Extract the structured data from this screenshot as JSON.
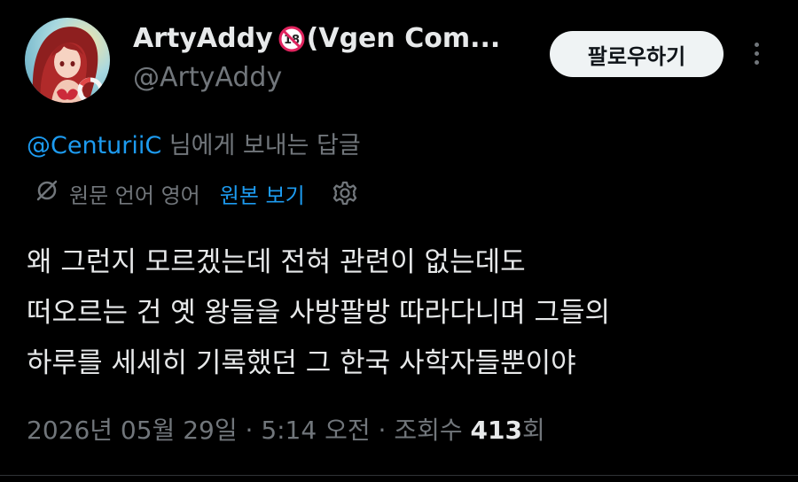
{
  "author": {
    "display_name": "ArtyAddy",
    "display_name_suffix": "(Vgen Com...",
    "age_badge_text": "18",
    "handle": "@ArtyAddy"
  },
  "header": {
    "follow_label": "팔로우하기"
  },
  "reply_context": {
    "mention": "@CenturiiC",
    "suffix": " 님에게 보내는 답글"
  },
  "translation": {
    "language_info": "원문 언어 영어",
    "show_original_label": "원본 보기"
  },
  "tweet": {
    "lines": [
      "왜 그런지 모르겠는데 전혀 관련이 없는데도",
      "떠오르는 건 옛 왕들을 사방팔방 따라다니며 그들의",
      "하루를 세세히 기록했던 그 한국 사학자들뿐이야"
    ]
  },
  "meta": {
    "date": "2026년 05월 29일",
    "separator": " · ",
    "time": "5:14 오전",
    "views_prefix": "조회수 ",
    "views_count": "413",
    "views_suffix": "회"
  },
  "colors": {
    "background": "#000000",
    "text_primary": "#e7e9ea",
    "text_secondary": "#71767b",
    "accent_blue": "#1d9bf0",
    "follow_button_bg": "#eff3f4",
    "age_badge_red": "#e0245e"
  },
  "icons": {
    "translate": "translate-icon",
    "settings": "gear-icon",
    "more": "more-icon",
    "age_restricted": "no-under-18-icon"
  }
}
